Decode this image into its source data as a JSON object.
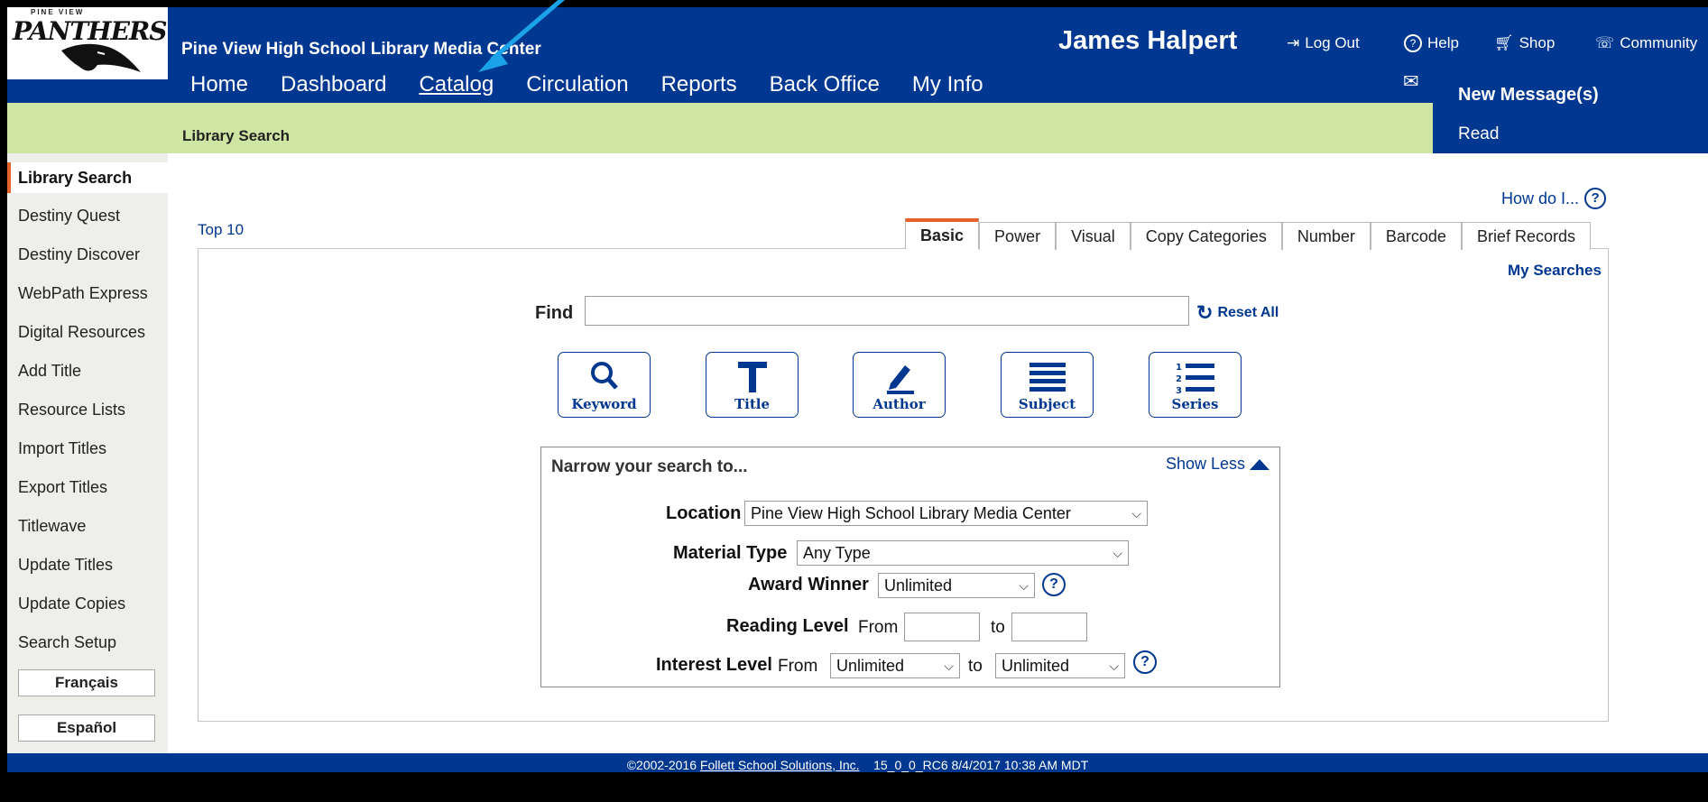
{
  "header": {
    "logo_text": "PANTHERS",
    "logo_top_text": "PINE VIEW",
    "school_name": "Pine View High School Library Media Center",
    "user_name": "James Halpert",
    "logout_label": "Log Out",
    "help_label": "Help",
    "shop_label": "Shop",
    "community_label": "Community",
    "nav": [
      "Home",
      "Dashboard",
      "Catalog",
      "Circulation",
      "Reports",
      "Back Office",
      "My Info"
    ],
    "active_nav": "Catalog",
    "new_messages_label": "New Message(s)",
    "read_label": "Read"
  },
  "subbar": {
    "title": "Library Search"
  },
  "sidebar": {
    "items": [
      "Library Search",
      "Destiny Quest",
      "Destiny Discover",
      "WebPath Express",
      "Digital Resources",
      "Add Title",
      "Resource Lists",
      "Import Titles",
      "Export Titles",
      "Titlewave",
      "Update Titles",
      "Update Copies",
      "Search Setup"
    ],
    "active": "Library Search",
    "languages": [
      "Français",
      "Español"
    ]
  },
  "main": {
    "how_do_i": "How do I...",
    "top10": "Top 10",
    "tabs": [
      "Basic",
      "Power",
      "Visual",
      "Copy Categories",
      "Number",
      "Barcode",
      "Brief Records"
    ],
    "active_tab": "Basic",
    "my_searches": "My Searches",
    "find_label": "Find",
    "find_value": "",
    "reset_all": "Reset All",
    "search_buttons": [
      "Keyword",
      "Title",
      "Author",
      "Subject",
      "Series"
    ]
  },
  "narrow": {
    "title": "Narrow your search to...",
    "show_less": "Show Less",
    "location_label": "Location",
    "location_value": "Pine View High School Library Media Center",
    "material_label": "Material Type",
    "material_value": "Any Type",
    "award_label": "Award Winner",
    "award_value": "Unlimited",
    "reading_label": "Reading Level",
    "from_label": "From",
    "to_label": "to",
    "interest_label": "Interest Level",
    "interest_from_value": "Unlimited",
    "interest_to_value": "Unlimited"
  },
  "footer": {
    "copyright": "©2002-2016",
    "company_link": "Follett School Solutions, Inc.",
    "version_info": "15_0_0_RC6   8/4/2017 10:38 AM MDT"
  },
  "colors": {
    "header_blue": "#003791",
    "accent_orange": "#e5622b",
    "subbar_green": "#cee5a3",
    "arrow_blue": "#1aa3e8"
  }
}
